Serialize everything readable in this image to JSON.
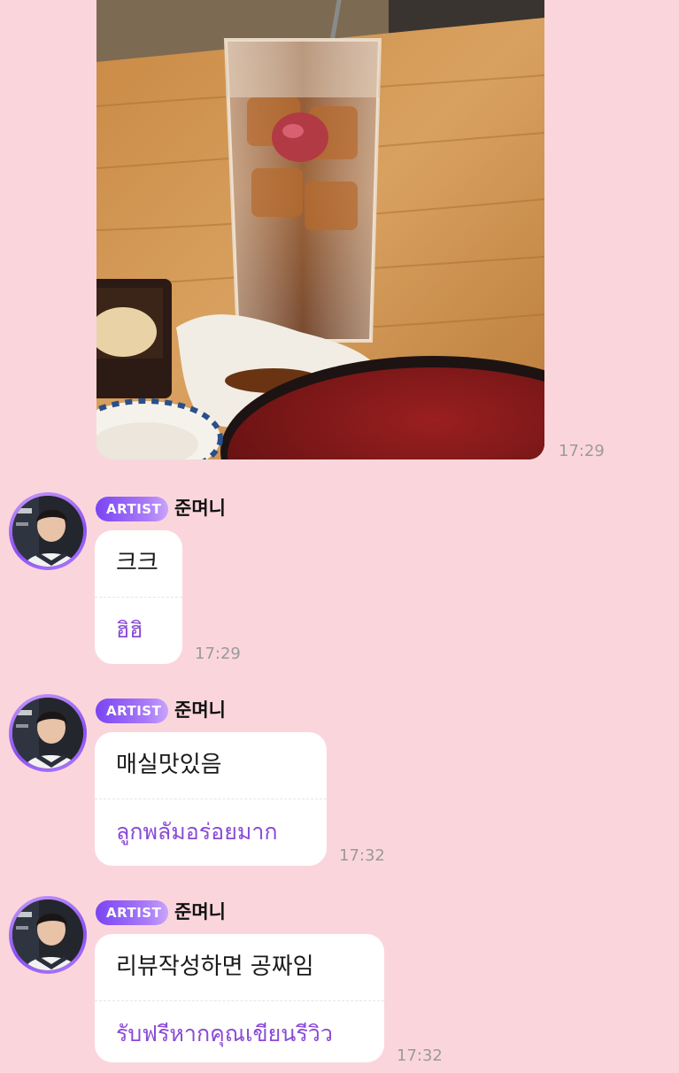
{
  "chat": {
    "photo_message": {
      "time": "17:29"
    },
    "messages": [
      {
        "badge": "ARTIST",
        "sender": "준며니",
        "text": "크크",
        "translation": "ฮิฮิ",
        "time": "17:29"
      },
      {
        "badge": "ARTIST",
        "sender": "준며니",
        "text": "매실맛있음",
        "translation": "ลูกพลัมอร่อยมาก",
        "time": "17:32"
      },
      {
        "badge": "ARTIST",
        "sender": "준며니",
        "text": "리뷰작성하면 공짜임",
        "translation": "รับฟรีหากคุณเขียนรีวิว",
        "time": "17:32"
      }
    ]
  },
  "colors": {
    "background": "#fad6dc",
    "bubble": "#ffffff",
    "translation_text": "#8a4ad6",
    "badge_gradient_start": "#7a45f2",
    "badge_gradient_end": "#c8a4fb",
    "avatar_ring": "#a06cf5",
    "timestamp": "#9a9a9a"
  },
  "icons": {
    "photo": "iced-tea-photo",
    "avatar": "artist-profile-photo"
  }
}
